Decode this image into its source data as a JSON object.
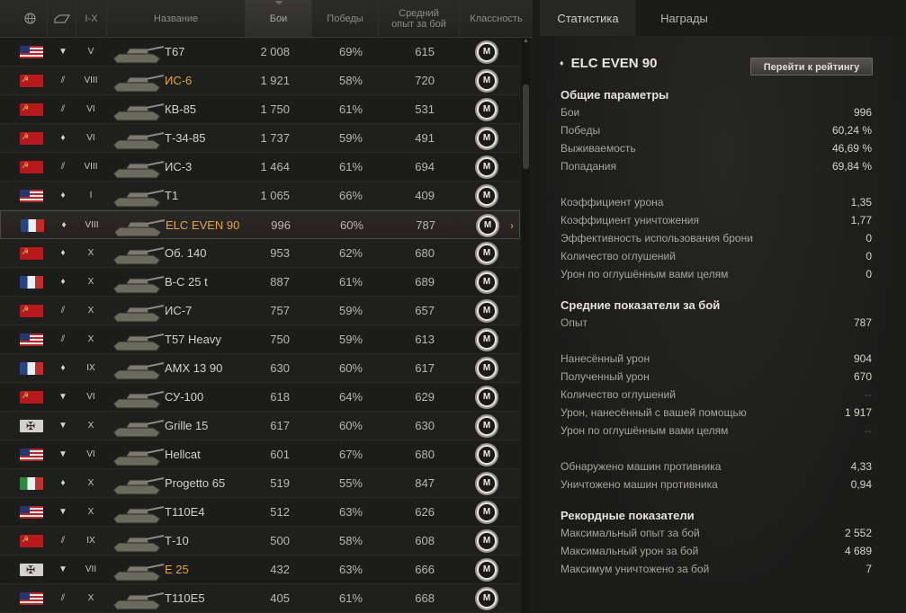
{
  "header": {
    "nation_icon": "globe-icon",
    "type_icon": "vehicle-type-icon",
    "tier": "I-X",
    "name": "Название",
    "battles": "Бои",
    "wins": "Победы",
    "avg_xp_line1": "Средний",
    "avg_xp_line2": "опыт за бой",
    "mastery": "Классность"
  },
  "rows": [
    {
      "flag": "usa",
      "type": "▼",
      "tier": "V",
      "name": "T67",
      "battles": "2 008",
      "wins": "69%",
      "xp": "615",
      "mastery": "M",
      "gold": false
    },
    {
      "flag": "ussr",
      "type": "⫽",
      "tier": "VIII",
      "name": "ИС-6",
      "battles": "1 921",
      "wins": "58%",
      "xp": "720",
      "mastery": "M",
      "gold": true
    },
    {
      "flag": "ussr",
      "type": "⫽",
      "tier": "VI",
      "name": "КВ-85",
      "battles": "1 750",
      "wins": "61%",
      "xp": "531",
      "mastery": "M",
      "gold": false
    },
    {
      "flag": "ussr",
      "type": "♦",
      "tier": "VI",
      "name": "Т-34-85",
      "battles": "1 737",
      "wins": "59%",
      "xp": "491",
      "mastery": "M",
      "gold": false
    },
    {
      "flag": "ussr",
      "type": "⫽",
      "tier": "VIII",
      "name": "ИС-3",
      "battles": "1 464",
      "wins": "61%",
      "xp": "694",
      "mastery": "M",
      "gold": false
    },
    {
      "flag": "usa",
      "type": "♦",
      "tier": "I",
      "name": "T1",
      "battles": "1 065",
      "wins": "66%",
      "xp": "409",
      "mastery": "M",
      "gold": false
    },
    {
      "flag": "france",
      "type": "♦",
      "tier": "VIII",
      "name": "ELC EVEN 90",
      "battles": "996",
      "wins": "60%",
      "xp": "787",
      "mastery": "M",
      "gold": true,
      "selected": true
    },
    {
      "flag": "ussr",
      "type": "♦",
      "tier": "X",
      "name": "Об. 140",
      "battles": "953",
      "wins": "62%",
      "xp": "680",
      "mastery": "M",
      "gold": false
    },
    {
      "flag": "france",
      "type": "♦",
      "tier": "X",
      "name": "B-C 25 t",
      "battles": "887",
      "wins": "61%",
      "xp": "689",
      "mastery": "M",
      "gold": false
    },
    {
      "flag": "ussr",
      "type": "⫽",
      "tier": "X",
      "name": "ИС-7",
      "battles": "757",
      "wins": "59%",
      "xp": "657",
      "mastery": "M",
      "gold": false
    },
    {
      "flag": "usa",
      "type": "⫽",
      "tier": "X",
      "name": "T57 Heavy",
      "battles": "750",
      "wins": "59%",
      "xp": "613",
      "mastery": "M",
      "gold": false
    },
    {
      "flag": "france",
      "type": "♦",
      "tier": "IX",
      "name": "AMX 13 90",
      "battles": "630",
      "wins": "60%",
      "xp": "617",
      "mastery": "M",
      "gold": false
    },
    {
      "flag": "ussr",
      "type": "▼",
      "tier": "VI",
      "name": "СУ-100",
      "battles": "618",
      "wins": "64%",
      "xp": "629",
      "mastery": "M",
      "gold": false
    },
    {
      "flag": "germany",
      "type": "▼",
      "tier": "X",
      "name": "Grille 15",
      "battles": "617",
      "wins": "60%",
      "xp": "630",
      "mastery": "M",
      "gold": false
    },
    {
      "flag": "usa",
      "type": "▼",
      "tier": "VI",
      "name": "Hellcat",
      "battles": "601",
      "wins": "67%",
      "xp": "680",
      "mastery": "M",
      "gold": false
    },
    {
      "flag": "italy",
      "type": "♦",
      "tier": "X",
      "name": "Progetto 65",
      "battles": "519",
      "wins": "55%",
      "xp": "847",
      "mastery": "M",
      "gold": false
    },
    {
      "flag": "usa",
      "type": "▼",
      "tier": "X",
      "name": "T110E4",
      "battles": "512",
      "wins": "63%",
      "xp": "626",
      "mastery": "M",
      "gold": false
    },
    {
      "flag": "ussr",
      "type": "⫽",
      "tier": "IX",
      "name": "Т-10",
      "battles": "500",
      "wins": "58%",
      "xp": "608",
      "mastery": "M",
      "gold": false
    },
    {
      "flag": "germany",
      "type": "▼",
      "tier": "VII",
      "name": "E 25",
      "battles": "432",
      "wins": "63%",
      "xp": "666",
      "mastery": "M",
      "gold": true
    },
    {
      "flag": "usa",
      "type": "⫽",
      "tier": "X",
      "name": "T110E5",
      "battles": "405",
      "wins": "61%",
      "xp": "668",
      "mastery": "M",
      "gold": false
    }
  ],
  "tabs": {
    "stats": "Статистика",
    "awards": "Награды"
  },
  "vehicle": {
    "marker": "♦",
    "name": "ELC EVEN 90",
    "rating_button": "Перейти к рейтингу"
  },
  "sections": [
    {
      "title": "Общие параметры",
      "rows": [
        {
          "label": "Бои",
          "value": "996"
        },
        {
          "label": "Победы",
          "value": "60,24 %"
        },
        {
          "label": "Выживаемость",
          "value": "46,69 %"
        },
        {
          "label": "Попадания",
          "value": "69,84 %"
        },
        {
          "label": "",
          "value": ""
        },
        {
          "label": "Коэффициент урона",
          "value": "1,35"
        },
        {
          "label": "Коэффициент уничтожения",
          "value": "1,77"
        },
        {
          "label": "Эффективность использования брони",
          "value": "0"
        },
        {
          "label": "Количество оглушений",
          "value": "0"
        },
        {
          "label": "Урон по оглушённым вами целям",
          "value": "0"
        }
      ]
    },
    {
      "title": "Средние показатели за бой",
      "rows": [
        {
          "label": "Опыт",
          "value": "787"
        },
        {
          "label": "",
          "value": ""
        },
        {
          "label": "Нанесённый урон",
          "value": "904"
        },
        {
          "label": "Полученный урон",
          "value": "670"
        },
        {
          "label": "Количество оглушений",
          "value": "--"
        },
        {
          "label": "Урон, нанесённый с вашей помощью",
          "value": "1 917"
        },
        {
          "label": "Урон по оглушённым вами целям",
          "value": "--"
        },
        {
          "label": "",
          "value": ""
        },
        {
          "label": "Обнаружено машин противника",
          "value": "4,33"
        },
        {
          "label": "Уничтожено машин противника",
          "value": "0,94"
        }
      ]
    },
    {
      "title": "Рекордные показатели",
      "rows": [
        {
          "label": "Максимальный опыт за бой",
          "value": "2 552"
        },
        {
          "label": "Максимальный урон за бой",
          "value": "4 689"
        },
        {
          "label": "Максимум уничтожено за бой",
          "value": "7"
        }
      ]
    }
  ]
}
